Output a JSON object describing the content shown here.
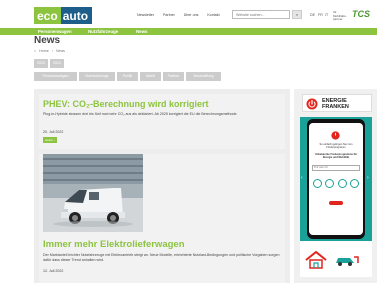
{
  "header": {
    "logo_eco": "eco",
    "logo_auto": "auto",
    "nav": [
      "Newsletter",
      "Partner",
      "Über uns",
      "Kontakt"
    ],
    "search_placeholder": "Website suchen...",
    "languages": [
      "DE",
      "FR",
      "IT"
    ],
    "partner_text": "Ihr Mobilitäts-partner",
    "partner_logo": "TCS"
  },
  "greennav": {
    "items": [
      "Personenwagen",
      "Nutzfahrzeuge",
      "News"
    ]
  },
  "page": {
    "title": "News",
    "breadcrumb": [
      "Home",
      "News"
    ]
  },
  "filters": {
    "row1": [
      "2022",
      "2021"
    ],
    "row2": [
      "Personenwagen",
      "Nutzfahrzeuge",
      "Politik",
      "Markt",
      "Partner",
      "Beschaffung"
    ]
  },
  "articles": [
    {
      "title": "PHEV: CO₂-Berechnung wird korrigiert",
      "text": "Plug-in-Hybride stossen drei bis fünf mal mehr CO₂ aus als deklariert. Ab 2025 korrigiert die EU die Berechnungsmethode.",
      "date": "20. Juli 2022",
      "more": "weiter ›"
    },
    {
      "title": "Immer mehr Elektrolieferwagen",
      "text": "Der Marktanteil leichter Nutzfahrzeuge mit Elektroantrieb steigt an. Neue Modelle, erleichterte Nutzlast-Bedingungen und politische Vorgaben sorgen dafür dass dieser Trend anhalten wird.",
      "date": "12. Juli 2022"
    }
  ],
  "sidebar": {
    "energie_line1": "ENERGIE",
    "energie_line2": "FRANKEN",
    "phone_text1": "So einfach gelingen Sie zum Förderprogramm",
    "phone_text2": "Unbekannte Förderprogramme für Energie und Mobilität",
    "phone_field": "PLZ oder Ort",
    "colors": {
      "teal": "#1aa29a",
      "green": "#8cc43f",
      "red": "#e2251d"
    }
  },
  "colors": {
    "brand_green": "#8cc43f",
    "brand_blue": "#1d5f8a"
  }
}
